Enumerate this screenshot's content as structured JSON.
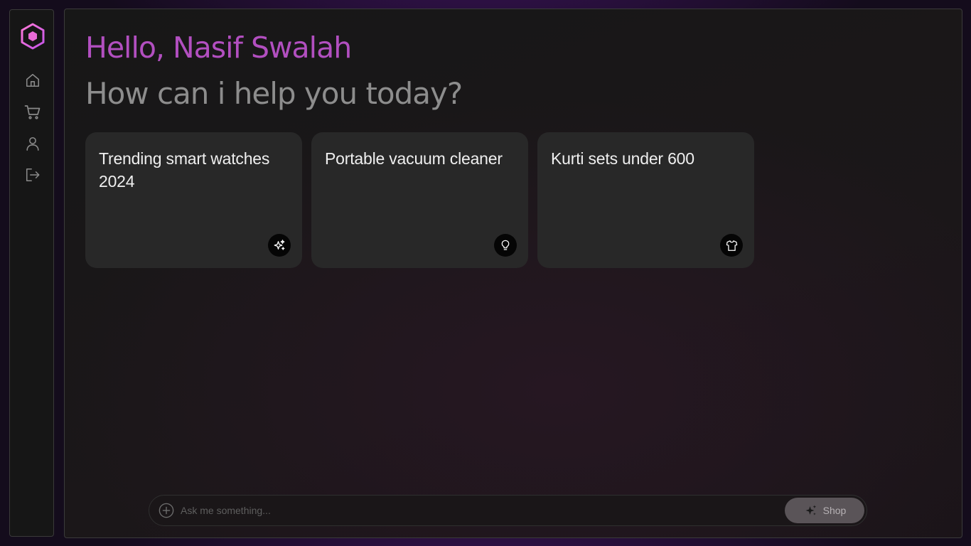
{
  "sidebar": {
    "logo_icon": "hexagon-logo-icon",
    "items": [
      {
        "name": "home",
        "icon": "home-icon"
      },
      {
        "name": "cart",
        "icon": "cart-icon"
      },
      {
        "name": "profile",
        "icon": "user-icon"
      },
      {
        "name": "logout",
        "icon": "logout-icon"
      }
    ]
  },
  "header": {
    "greeting": "Hello, Nasif Swalah",
    "subtitle": "How can i help you today?"
  },
  "cards": [
    {
      "text": "Trending smart watches 2024",
      "icon": "sparkles-icon"
    },
    {
      "text": "Portable vacuum cleaner",
      "icon": "lightbulb-icon"
    },
    {
      "text": "Kurti sets under 600",
      "icon": "shirt-icon"
    }
  ],
  "prompt_bar": {
    "placeholder": "Ask me something...",
    "value": "",
    "submit_label": "Shop",
    "add_icon": "plus-circle-icon",
    "submit_icon": "sparkles-icon"
  },
  "colors": {
    "greeting": "#b24fc0",
    "subtitle": "#8d8d8d",
    "card_bg": "#282828",
    "accent_logo": "#e060d0"
  }
}
